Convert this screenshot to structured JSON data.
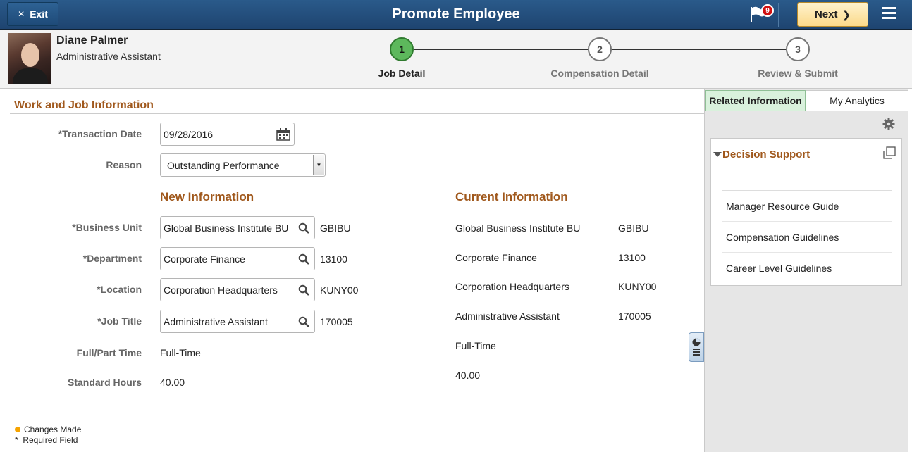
{
  "header": {
    "exit_label": "Exit",
    "title": "Promote Employee",
    "notification_count": "9",
    "next_label": "Next"
  },
  "employee": {
    "name": "Diane Palmer",
    "job_title": "Administrative Assistant"
  },
  "steps": [
    {
      "number": "1",
      "label": "Job Detail"
    },
    {
      "number": "2",
      "label": "Compensation Detail"
    },
    {
      "number": "3",
      "label": "Review & Submit"
    }
  ],
  "section": {
    "title": "Work and Job Information"
  },
  "form": {
    "transaction_date_label": "*Transaction Date",
    "transaction_date_value": "09/28/2016",
    "reason_label": "Reason",
    "reason_value": "Outstanding Performance",
    "new_info_title": "New Information",
    "current_info_title": "Current Information",
    "business_unit_label": "*Business Unit",
    "department_label": "*Department",
    "location_label": "*Location",
    "job_title_label": "*Job Title",
    "full_part_label": "Full/Part Time",
    "std_hours_label": "Standard Hours"
  },
  "new_info": {
    "business_unit": "Global Business Institute BU",
    "business_unit_code": "GBIBU",
    "department": "Corporate Finance",
    "department_code": "13100",
    "location": "Corporation Headquarters",
    "location_code": "KUNY00",
    "job_title": "Administrative Assistant",
    "job_title_code": "170005",
    "full_part": "Full-Time",
    "std_hours": "40.00"
  },
  "current_info": {
    "business_unit": "Global Business Institute BU",
    "business_unit_code": "GBIBU",
    "department": "Corporate Finance",
    "department_code": "13100",
    "location": "Corporation Headquarters",
    "location_code": "KUNY00",
    "job_title": "Administrative Assistant",
    "job_title_code": "170005",
    "full_part": "Full-Time",
    "std_hours": "40.00"
  },
  "legend": {
    "changes_made": "Changes Made",
    "required_marker": "*",
    "required_field": "Required Field"
  },
  "right_panel": {
    "tab_related": "Related Information",
    "tab_analytics": "My Analytics",
    "decision_support_title": "Decision Support",
    "links": [
      "Manager Resource Guide",
      "Compensation Guidelines",
      "Career Level Guidelines"
    ]
  },
  "colors": {
    "header_bg": "#1e4470",
    "accent_orange": "#a0581c",
    "step_active": "#5db85c",
    "next_button": "#fbd98a"
  }
}
